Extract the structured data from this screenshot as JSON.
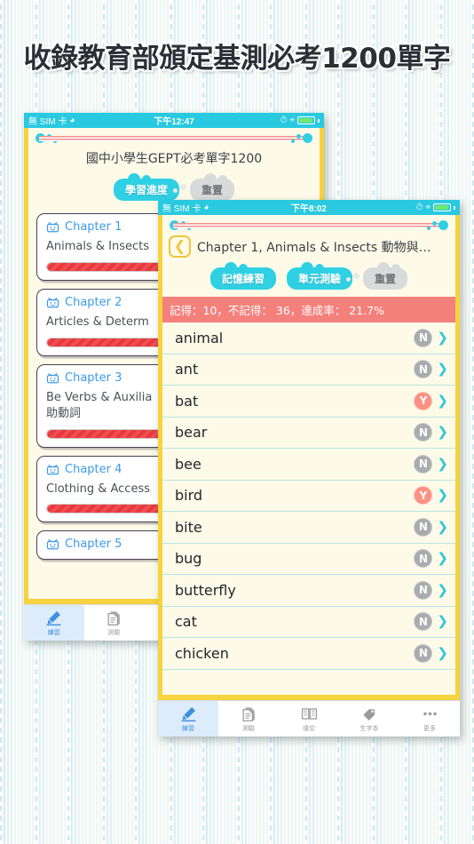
{
  "headline": "收錄教育部頒定基測必考1200單字",
  "colors": {
    "accent_cyan": "#2fd0e4",
    "frame_yellow": "#f6d33f",
    "screen_cream": "#fdfbe8",
    "progress_red": "#e8383c",
    "stat_salmon": "#f4807c",
    "tab_active_blue": "#3d8fe0"
  },
  "left_phone": {
    "status_bar": {
      "carrier": "無 SIM 卡",
      "wifi_icon": "wifi-icon",
      "time": "下午12:47",
      "alarm_icon": "alarm-icon",
      "bluetooth_icon": "bluetooth-icon",
      "battery_icon": "battery-icon"
    },
    "app_title": "國中小學生GEPT必考單字1200",
    "buttons": {
      "progress_label": "學習進度",
      "reset_label": "重置"
    },
    "chapters": [
      {
        "number": "Chapter 1",
        "name": "Animals & Insects",
        "name2": "",
        "progress": 62
      },
      {
        "number": "Chapter 2",
        "name": "Articles & Determ",
        "name2": "",
        "progress": 58
      },
      {
        "number": "Chapter 3",
        "name": "Be Verbs & Auxilia",
        "name2": "助動詞",
        "progress": 93
      },
      {
        "number": "Chapter 4",
        "name": "Clothing & Access",
        "name2": "",
        "progress": 100
      },
      {
        "number": "Chapter 5",
        "name": "",
        "name2": "",
        "progress": 0
      }
    ],
    "tabs": [
      {
        "label": "練習",
        "icon": "pencil-icon",
        "active": true
      },
      {
        "label": "測驗",
        "icon": "document-icon",
        "active": false
      }
    ]
  },
  "right_phone": {
    "status_bar": {
      "carrier": "無 SIM 卡",
      "wifi_icon": "wifi-icon",
      "time": "下午8:02",
      "alarm_icon": "alarm-icon",
      "bluetooth_icon": "bluetooth-icon",
      "battery_icon": "battery-icon"
    },
    "nav": {
      "back_icon": "back-arrow-icon",
      "title": "Chapter 1, Animals & Insects 動物與…"
    },
    "buttons": {
      "memory_practice": "記憶練習",
      "unit_test": "單元測驗",
      "reset": "重置"
    },
    "stat_line": "記得：10，不記得： 36，達成率： 21.7%",
    "words": [
      {
        "word": "animal",
        "status": "N"
      },
      {
        "word": "ant",
        "status": "N"
      },
      {
        "word": "bat",
        "status": "Y"
      },
      {
        "word": "bear",
        "status": "N"
      },
      {
        "word": "bee",
        "status": "N"
      },
      {
        "word": "bird",
        "status": "Y"
      },
      {
        "word": "bite",
        "status": "N"
      },
      {
        "word": "bug",
        "status": "N"
      },
      {
        "word": "butterfly",
        "status": "N"
      },
      {
        "word": "cat",
        "status": "N"
      },
      {
        "word": "chicken",
        "status": "N"
      }
    ],
    "tabs": [
      {
        "label": "練習",
        "icon": "pencil-icon",
        "active": true
      },
      {
        "label": "測驗",
        "icon": "document-icon",
        "active": false
      },
      {
        "label": "填空",
        "icon": "book-icon",
        "active": false
      },
      {
        "label": "生字本",
        "icon": "tag-icon",
        "active": false
      },
      {
        "label": "更多",
        "icon": "more-dots-icon",
        "active": false
      }
    ]
  }
}
